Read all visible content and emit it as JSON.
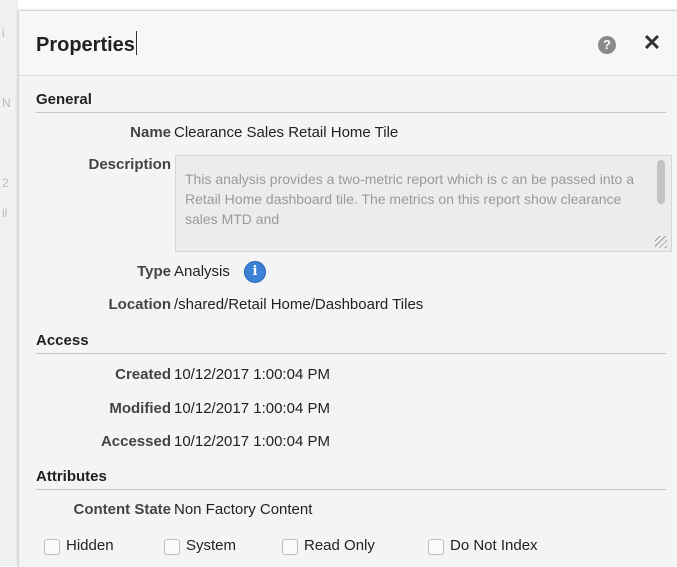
{
  "dialog": {
    "title": "Properties",
    "help_glyph": "?",
    "close_glyph": "✕",
    "icons": [
      "help-icon",
      "close-icon"
    ]
  },
  "general": {
    "heading": "General",
    "name_label": "Name",
    "name_value": "Clearance Sales Retail Home Tile",
    "description_label": "Description",
    "description_value": "This analysis provides a two-metric report which is c an be passed into a Retail Home dashboard tile. The metrics on this report show clearance sales MTD and",
    "type_label": "Type",
    "type_value": "Analysis",
    "type_info_icon": "info-icon",
    "info_glyph": "i",
    "location_label": "Location",
    "location_value": "/shared/Retail Home/Dashboard Tiles"
  },
  "access": {
    "heading": "Access",
    "created_label": "Created",
    "created_value": "10/12/2017 1:00:04 PM",
    "modified_label": "Modified",
    "modified_value": "10/12/2017 1:00:04 PM",
    "accessed_label": "Accessed",
    "accessed_value": "10/12/2017 1:00:04 PM"
  },
  "attributes": {
    "heading": "Attributes",
    "content_state_label": "Content State",
    "content_state_value": "Non Factory Content",
    "checkboxes": [
      {
        "label": "Hidden",
        "checked": false
      },
      {
        "label": "System",
        "checked": false
      },
      {
        "label": "Read Only",
        "checked": false
      },
      {
        "label": "Do Not Index",
        "checked": false
      }
    ]
  },
  "colors": {
    "dialog_bg": "#f4f4f4",
    "info_icon": "#3b82d6",
    "section_rule": "#c6c6c6"
  }
}
